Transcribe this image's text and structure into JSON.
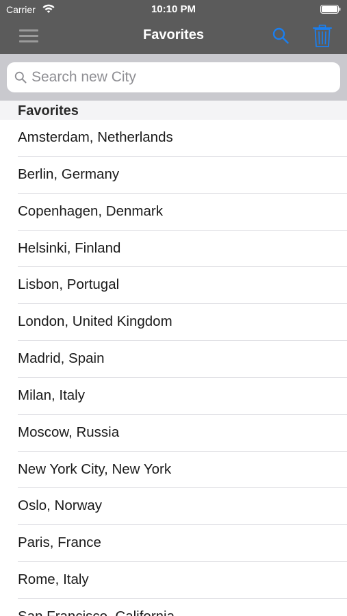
{
  "status_bar": {
    "carrier": "Carrier",
    "time": "10:10 PM",
    "icons": [
      "wifi-icon",
      "battery-icon"
    ]
  },
  "nav_bar": {
    "title": "Favorites",
    "left_icon": "menu-icon",
    "right_icons": [
      "search-icon",
      "trash-icon"
    ],
    "accent_color": "#1a7ff0",
    "background_color": "#5b5b5b"
  },
  "search": {
    "value": "",
    "placeholder": "Search new City",
    "icon": "search-icon"
  },
  "section": {
    "title": "Favorites"
  },
  "cities": [
    {
      "label": "Amsterdam, Netherlands"
    },
    {
      "label": "Berlin, Germany"
    },
    {
      "label": "Copenhagen, Denmark"
    },
    {
      "label": "Helsinki, Finland"
    },
    {
      "label": "Lisbon, Portugal"
    },
    {
      "label": "London, United Kingdom"
    },
    {
      "label": "Madrid, Spain"
    },
    {
      "label": "Milan, Italy"
    },
    {
      "label": "Moscow, Russia"
    },
    {
      "label": "New York City, New York"
    },
    {
      "label": "Oslo, Norway"
    },
    {
      "label": "Paris, France"
    },
    {
      "label": "Rome, Italy"
    },
    {
      "label": "San Francisco, California"
    }
  ]
}
